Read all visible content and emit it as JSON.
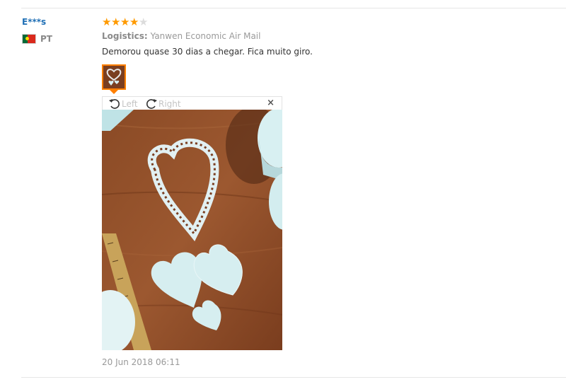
{
  "review": {
    "user": "E***s",
    "country": {
      "code": "PT",
      "flag": "portugal-flag-icon"
    },
    "rating": {
      "value": 4,
      "max": 5,
      "color": "#ff9a00"
    },
    "logistics": {
      "label": "Logistics:",
      "value": "Yanwen Economic Air Mail"
    },
    "text": "Demorou quase 30 dias a chegar. Fica muito giro.",
    "viewer": {
      "rotate_left": "Left",
      "rotate_right": "Right",
      "close": "×"
    },
    "date": "20 Jun 2018 06:11"
  }
}
